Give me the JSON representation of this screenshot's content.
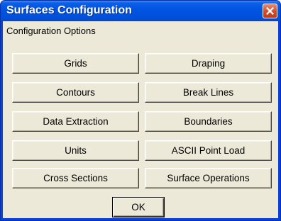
{
  "window": {
    "title": "Surfaces Configuration",
    "close_icon": "close-icon"
  },
  "section_label": "Configuration Options",
  "buttons": [
    {
      "label": "Grids"
    },
    {
      "label": "Draping"
    },
    {
      "label": "Contours"
    },
    {
      "label": "Break Lines"
    },
    {
      "label": "Data Extraction"
    },
    {
      "label": "Boundaries"
    },
    {
      "label": "Units"
    },
    {
      "label": "ASCII Point Load"
    },
    {
      "label": "Cross Sections"
    },
    {
      "label": "Surface Operations"
    }
  ],
  "ok_label": "OK",
  "colors": {
    "titlebar": "#0053e1",
    "client_background": "#ece9d8",
    "close_button": "#d54a26"
  }
}
